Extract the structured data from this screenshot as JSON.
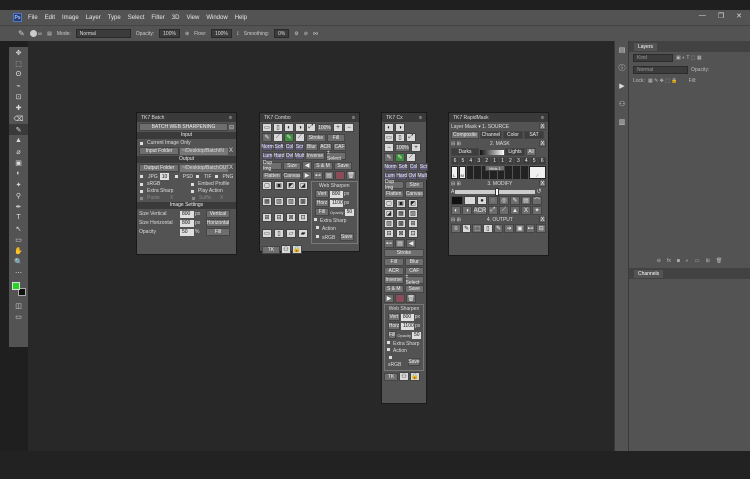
{
  "menubar": {
    "app_icon": "Ps",
    "items": [
      "File",
      "Edit",
      "Image",
      "Layer",
      "Type",
      "Select",
      "Filter",
      "3D",
      "View",
      "Window",
      "Help"
    ],
    "window_controls": [
      "—",
      "❐",
      "✕"
    ]
  },
  "options": {
    "mode_label": "Mode:",
    "mode_value": "Normal",
    "opacity_label": "Opacity:",
    "opacity_value": "100%",
    "flow_label": "Flow:",
    "flow_value": "100%",
    "smoothing_label": "Smoothing:",
    "smoothing_value": "0%",
    "brush_size": "60"
  },
  "tools": [
    "✥",
    "⬚",
    "ʘ",
    "⌁",
    "⊡",
    "✚",
    "⌫",
    "✎",
    "▲",
    "⌀",
    "▣",
    "◐",
    "✦",
    "⚲",
    "✒",
    "T",
    "↖",
    "▭",
    "✋",
    "🔍",
    "⋯"
  ],
  "colors": {
    "foreground": "#22d622",
    "background": "#111111"
  },
  "layers_panel": {
    "tab": "Layers",
    "kind": "Kind",
    "mode": "Normal",
    "opacity_label": "Opacity:",
    "lock_label": "Lock:",
    "fill_label": "Fill:"
  },
  "channels_panel": {
    "tab": "Channels"
  },
  "batch": {
    "title": "TK7 Batch",
    "header": "BATCH WEB SHARPENING",
    "input_label": "Input",
    "current_image": "Current Image Only",
    "input_folder": "Input Folder",
    "path1": "~/Desktop/BatchIN",
    "output_label": "Output",
    "output_folder": "Output Folder",
    "path2": "~/Desktop/BatchOUT",
    "jpg": "JPG",
    "jpg_q": "10",
    "psd": "PSD",
    "tif": "TIF",
    "png": "PNG",
    "srgb": "sRGB",
    "embed": "Embed Profile",
    "extra": "Extra Sharp",
    "play": "Play Action",
    "paste": "Paste",
    "suffix": "Suffix",
    "settings_label": "Image Settings",
    "size_v": "Size Vertical",
    "size_v_val": "800",
    "px": "px",
    "vertical": "Vertical",
    "size_h": "Size Horizontal",
    "size_h_val": "800",
    "horizontal": "Horizontal",
    "opacity": "Opacity",
    "opacity_val": "50",
    "pct": "%",
    "fill": "Fill"
  },
  "combo": {
    "title": "TK7 Combo",
    "pct": "100%",
    "stroke": "Stroke",
    "fill": "Fill",
    "r1": [
      "Norm",
      "Soft",
      "Col",
      "Scr"
    ],
    "r2": [
      "Lum",
      "Hard",
      "Ovl",
      "Mult"
    ],
    "blur": "Blur",
    "acr": "ACR",
    "caf": "CAF",
    "inverse": "Inverse",
    "select": "± Select",
    "dup": "Dup Img",
    "size": "Size",
    "sm": "S & M",
    "save": "Save",
    "flatten": "Flatten",
    "canvas": "Canvas",
    "websharpen": "Web Sharpen",
    "vert": "Vert",
    "vert_val": "800",
    "horz": "Horz",
    "horz_val": "1100",
    "px": "px",
    "fill2": "Fill",
    "opacity_label": "Opacity",
    "opacity_val": "50",
    "extra": "Extra Sharp",
    "action": "Action",
    "srgb": "sRGB",
    "save2": "Save",
    "tk": "TK"
  },
  "cx": {
    "title": "TK7 Cx",
    "pct": "100%",
    "r1": [
      "Norm",
      "Soft",
      "Col",
      "Scr"
    ],
    "r2": [
      "Lum",
      "Hard",
      "Ovl",
      "Mult"
    ],
    "dup": "Dup Img",
    "size": "Size",
    "flatten": "Flatten",
    "canvas": "Canvas",
    "stroke": "Stroke",
    "fill": "Fill",
    "blur": "Blur",
    "acr": "ACR",
    "caf": "CAF",
    "inverse": "Inverse",
    "select": "± Select",
    "sm": "S & M",
    "save": "Save",
    "websharpen": "Web Sharpen",
    "vert": "Vert",
    "vert_val": "800",
    "horz": "Horz",
    "horz_val": "1100",
    "px": "px",
    "fill2": "Fill",
    "opacity_label": "Opacity",
    "opacity_val": "50",
    "extra": "Extra Sharp",
    "action": "Action",
    "srgb": "sRGB",
    "save2": "Save",
    "tk": "TK"
  },
  "rapid": {
    "title": "TK7 RapidMask",
    "source": "Layer Mask ▾  1. SOURCE",
    "comp": "Composite",
    "channel": "Channel",
    "color": "Color",
    "sat": "SAT",
    "mask": "2. MASK",
    "darks": "Darks",
    "lights": "Lights",
    "all": "All",
    "nums": [
      "6",
      "5",
      "4",
      "3",
      "2",
      "1",
      "1",
      "2",
      "3",
      "4",
      "5",
      "6"
    ],
    "mids": "Mids 1",
    "modify": "3. MODIFY",
    "output": "4. OUTPUT",
    "acr": "ACR",
    "x": "X"
  }
}
